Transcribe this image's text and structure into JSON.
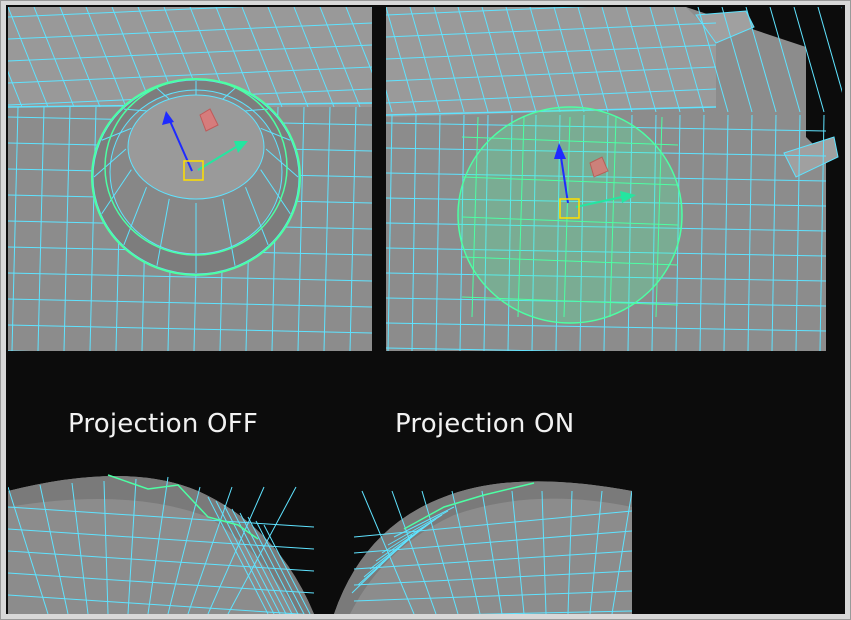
{
  "captions": {
    "projection_off": "Projection OFF",
    "projection_on": "Projection ON"
  },
  "colors": {
    "background": "#0c0c0c",
    "mesh_fill": "#8a8a8a",
    "wireframe": "#5fe3ff",
    "selection": "#4dffa4",
    "gizmo_y": "#1f2bff",
    "gizmo_x": "#24e6a0",
    "gizmo_plane": "#f07070",
    "gizmo_pivot": "#ffe000"
  },
  "icons": {
    "move_y_axis": "move-y-arrow-icon",
    "move_x_axis": "move-x-arrow-icon",
    "move_plane": "move-plane-handle-icon",
    "pivot": "pivot-square-icon"
  }
}
